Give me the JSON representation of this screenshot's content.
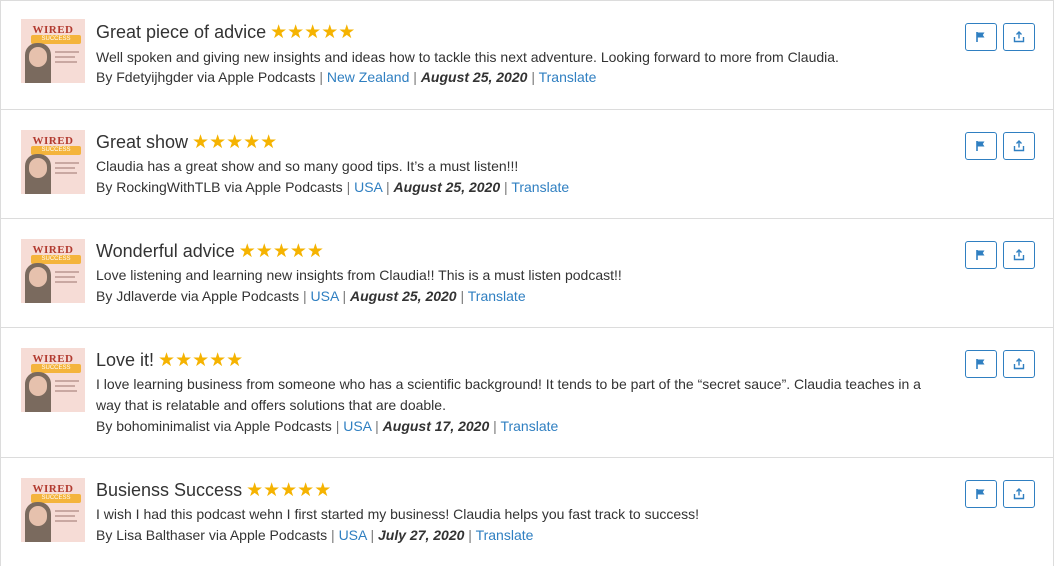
{
  "reviews": [
    {
      "title": "Great piece of advice",
      "stars": "★★★★★",
      "rating": 5,
      "body": "Well spoken and giving new insights and ideas how to tackle this next adventure. Looking forward to more from Claudia.",
      "author_prefix": "By Fdetyijhgder via Apple Podcasts",
      "country": "New Zealand",
      "date": "August 25, 2020",
      "translate": "Translate"
    },
    {
      "title": "Great show",
      "stars": "★★★★★",
      "rating": 5,
      "body": "Claudia has a great show and so many good tips. It’s a must listen!!!",
      "author_prefix": "By RockingWithTLB via Apple Podcasts",
      "country": "USA",
      "date": "August 25, 2020",
      "translate": "Translate"
    },
    {
      "title": "Wonderful advice",
      "stars": "★★★★★",
      "rating": 5,
      "body": "Love listening and learning new insights from Claudia!! This is a must listen podcast!!",
      "author_prefix": "By Jdlaverde via Apple Podcasts",
      "country": "USA",
      "date": "August 25, 2020",
      "translate": "Translate"
    },
    {
      "title": "Love it!",
      "stars": "★★★★★",
      "rating": 5,
      "body": "I love learning business from someone who has a scientific background! It tends to be part of the “secret sauce”. Claudia teaches in a way that is relatable and offers solutions that are doable.",
      "author_prefix": "By bohominimalist via Apple Podcasts",
      "country": "USA",
      "date": "August 17, 2020",
      "translate": "Translate"
    },
    {
      "title": "Busienss Success",
      "stars": "★★★★★",
      "rating": 5,
      "body": "I wish I had this podcast wehn I first started my business! Claudia helps you fast track to success!",
      "author_prefix": "By Lisa Balthaser via Apple Podcasts",
      "country": "USA",
      "date": "July 27, 2020",
      "translate": "Translate"
    }
  ],
  "cover": {
    "wordmark": "WIRED",
    "banner": "SUCCESS"
  },
  "separator": "|",
  "icons": {
    "flag": "flag-icon",
    "share": "share-icon"
  },
  "colors": {
    "link": "#2f7fc1",
    "star": "#f5b301",
    "button_border": "#2f7fc1"
  }
}
